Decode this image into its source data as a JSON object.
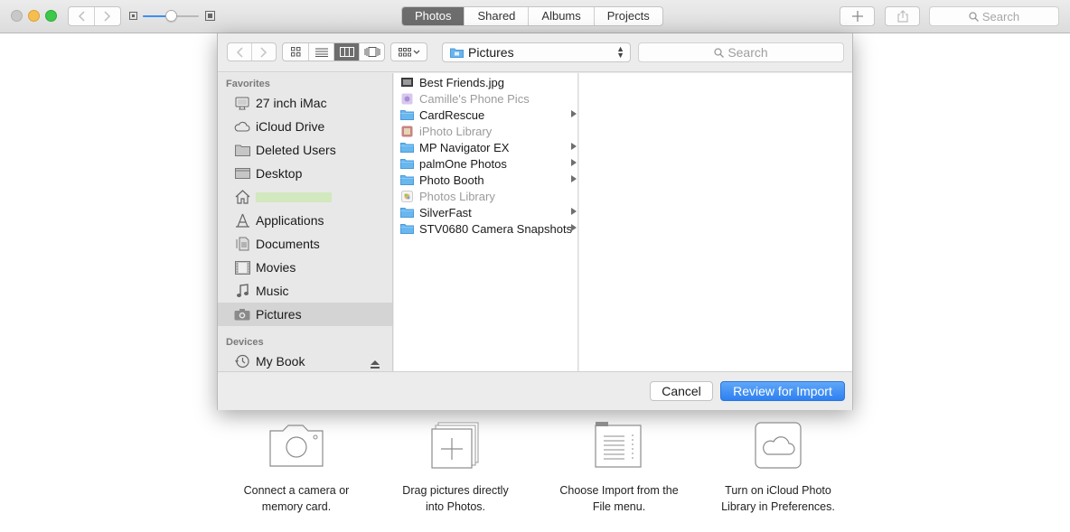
{
  "toolbar": {
    "tabs": [
      {
        "label": "Photos",
        "active": true
      },
      {
        "label": "Shared",
        "active": false
      },
      {
        "label": "Albums",
        "active": false
      },
      {
        "label": "Projects",
        "active": false
      }
    ],
    "search_placeholder": "Search"
  },
  "dialog": {
    "location": "Pictures",
    "search_placeholder": "Search",
    "sidebar": {
      "favorites_header": "Favorites",
      "favorites": [
        {
          "label": "27 inch iMac",
          "icon": "imac-icon"
        },
        {
          "label": "iCloud Drive",
          "icon": "cloud-icon"
        },
        {
          "label": "Deleted Users",
          "icon": "folder-icon"
        },
        {
          "label": "Desktop",
          "icon": "desktop-icon"
        },
        {
          "label": "",
          "icon": "home-icon",
          "redacted": true
        },
        {
          "label": "Applications",
          "icon": "applications-icon"
        },
        {
          "label": "Documents",
          "icon": "documents-icon"
        },
        {
          "label": "Movies",
          "icon": "movies-icon"
        },
        {
          "label": "Music",
          "icon": "music-icon"
        },
        {
          "label": "Pictures",
          "icon": "camera-icon",
          "selected": true
        }
      ],
      "devices_header": "Devices",
      "devices": [
        {
          "label": "My Book",
          "icon": "time-machine-icon"
        }
      ]
    },
    "files": [
      {
        "name": "Best Friends.jpg",
        "kind": "image",
        "dim": false,
        "has_children": false
      },
      {
        "name": "Camille's Phone Pics",
        "kind": "library",
        "dim": true,
        "has_children": false
      },
      {
        "name": "CardRescue",
        "kind": "folder",
        "dim": false,
        "has_children": true
      },
      {
        "name": "iPhoto Library",
        "kind": "iphoto",
        "dim": true,
        "has_children": false
      },
      {
        "name": "MP Navigator EX",
        "kind": "folder",
        "dim": false,
        "has_children": true
      },
      {
        "name": "palmOne Photos",
        "kind": "folder",
        "dim": false,
        "has_children": true
      },
      {
        "name": "Photo Booth",
        "kind": "folder",
        "dim": false,
        "has_children": true
      },
      {
        "name": "Photos Library",
        "kind": "photos",
        "dim": true,
        "has_children": false
      },
      {
        "name": "SilverFast",
        "kind": "folder",
        "dim": false,
        "has_children": true
      },
      {
        "name": "STV0680 Camera Snapshots",
        "kind": "folder",
        "dim": false,
        "has_children": true
      }
    ],
    "cancel_label": "Cancel",
    "review_label": "Review for Import",
    "accent_color": "#2e80f1"
  },
  "hints": [
    {
      "icon": "camera-outline-icon",
      "text": "Connect a camera or\nmemory card."
    },
    {
      "icon": "drag-pictures-icon",
      "text": "Drag pictures directly\ninto Photos."
    },
    {
      "icon": "file-menu-icon",
      "text": "Choose Import from the\nFile menu."
    },
    {
      "icon": "icloud-photo-icon",
      "text": "Turn on iCloud Photo\nLibrary in Preferences."
    }
  ]
}
